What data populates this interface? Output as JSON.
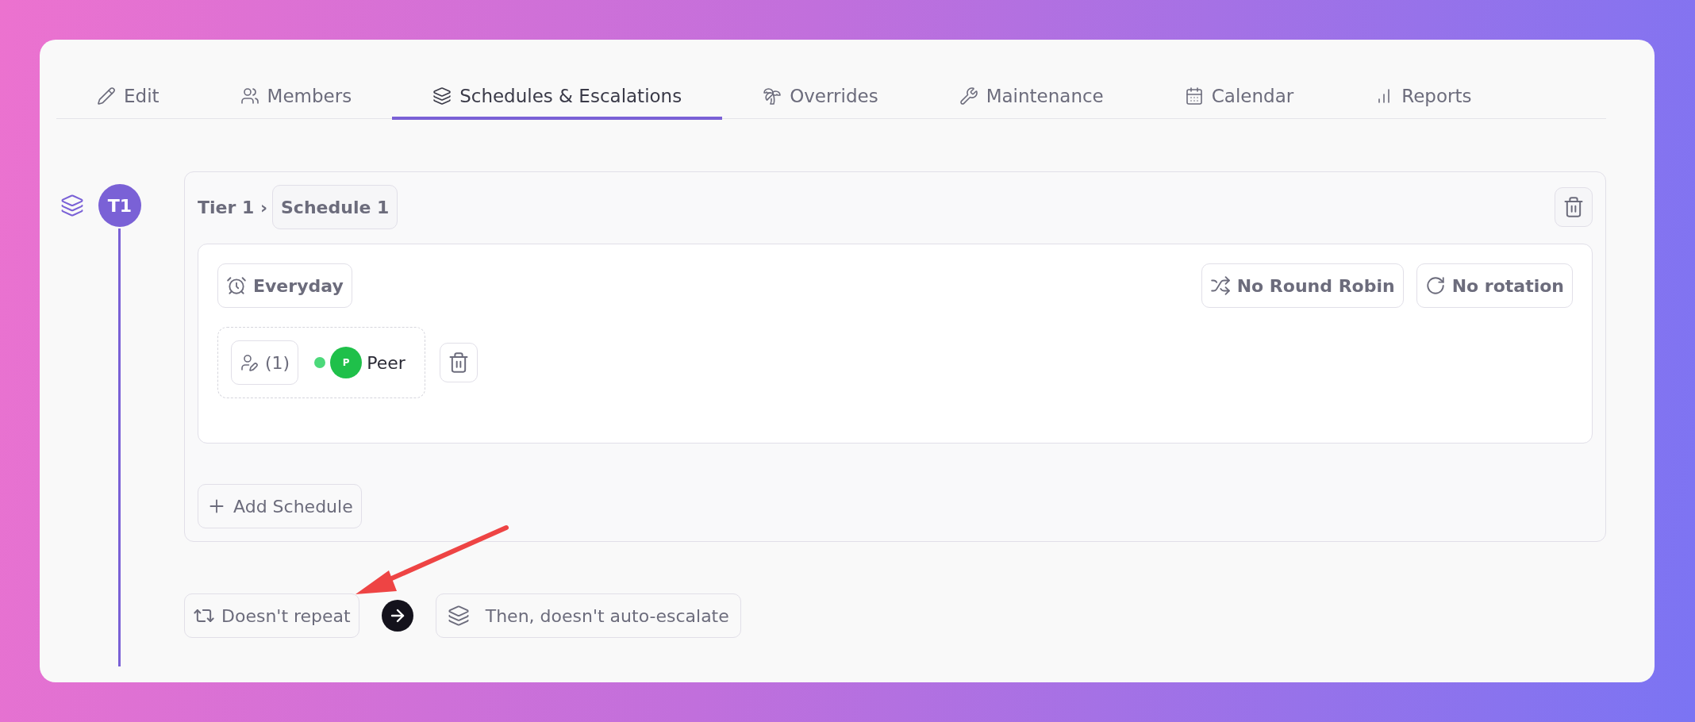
{
  "tabs": [
    {
      "label": "Edit",
      "selected": false
    },
    {
      "label": "Members",
      "selected": false
    },
    {
      "label": "Schedules & Escalations",
      "selected": true
    },
    {
      "label": "Overrides",
      "selected": false
    },
    {
      "label": "Maintenance",
      "selected": false
    },
    {
      "label": "Calendar",
      "selected": false
    },
    {
      "label": "Reports",
      "selected": false
    }
  ],
  "tier": {
    "badge": "T1",
    "breadcrumb": "Tier 1 ›",
    "schedule_name": "Schedule 1",
    "schedule": {
      "days": "Everyday",
      "round_robin": "No Round Robin",
      "rotation": "No rotation",
      "responders": {
        "count": "(1)",
        "members": [
          {
            "initial": "P",
            "name": "Peer",
            "online": true,
            "color": "#1fc04a"
          }
        ]
      }
    },
    "add_button": "Add Schedule"
  },
  "repeat": "Doesn't repeat",
  "escalation": "Then, doesn't auto-escalate"
}
